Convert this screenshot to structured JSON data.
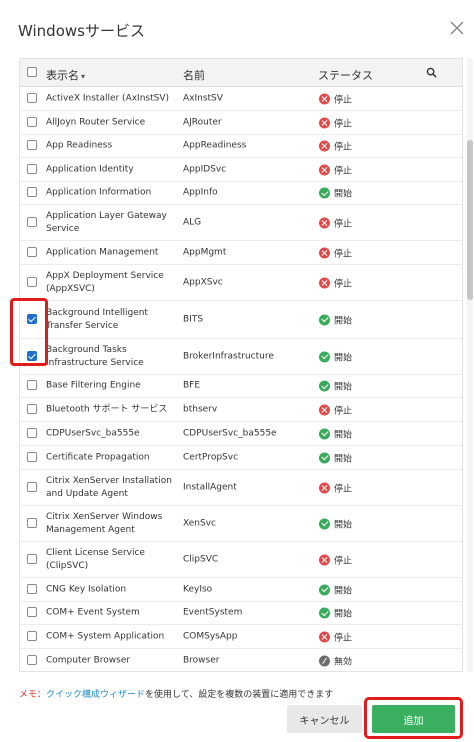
{
  "dialog": {
    "title": "Windowsサービス"
  },
  "table": {
    "headers": {
      "display_name": "表示名",
      "name": "名前",
      "status": "ステータス"
    },
    "rows": [
      {
        "display": "ActiveX Installer (AxInstSV)",
        "name": "AxInstSV",
        "status": "停止",
        "state": "stop",
        "checked": false
      },
      {
        "display": "AllJoyn Router Service",
        "name": "AJRouter",
        "status": "停止",
        "state": "stop",
        "checked": false
      },
      {
        "display": "App Readiness",
        "name": "AppReadiness",
        "status": "停止",
        "state": "stop",
        "checked": false
      },
      {
        "display": "Application Identity",
        "name": "AppIDSvc",
        "status": "停止",
        "state": "stop",
        "checked": false
      },
      {
        "display": "Application Information",
        "name": "AppInfo",
        "status": "開始",
        "state": "run",
        "checked": false
      },
      {
        "display": "Application Layer Gateway Service",
        "name": "ALG",
        "status": "停止",
        "state": "stop",
        "checked": false
      },
      {
        "display": "Application Management",
        "name": "AppMgmt",
        "status": "停止",
        "state": "stop",
        "checked": false
      },
      {
        "display": "AppX Deployment Service (AppXSVC)",
        "name": "AppXSvc",
        "status": "停止",
        "state": "stop",
        "checked": false
      },
      {
        "display": "Background Intelligent Transfer Service",
        "name": "BITS",
        "status": "開始",
        "state": "run",
        "checked": true
      },
      {
        "display": "Background Tasks Infrastructure Service",
        "name": "BrokerInfrastructure",
        "status": "開始",
        "state": "run",
        "checked": true
      },
      {
        "display": "Base Filtering Engine",
        "name": "BFE",
        "status": "開始",
        "state": "run",
        "checked": false
      },
      {
        "display": "Bluetooth サポート サービス",
        "name": "bthserv",
        "status": "停止",
        "state": "stop",
        "checked": false
      },
      {
        "display": "CDPUserSvc_ba555e",
        "name": "CDPUserSvc_ba555e",
        "status": "開始",
        "state": "run",
        "checked": false
      },
      {
        "display": "Certificate Propagation",
        "name": "CertPropSvc",
        "status": "開始",
        "state": "run",
        "checked": false
      },
      {
        "display": "Citrix XenServer Installation and Update Agent",
        "name": "InstallAgent",
        "status": "停止",
        "state": "stop",
        "checked": false
      },
      {
        "display": "Citrix XenServer Windows Management Agent",
        "name": "XenSvc",
        "status": "開始",
        "state": "run",
        "checked": false
      },
      {
        "display": "Client License Service (ClipSVC)",
        "name": "ClipSVC",
        "status": "停止",
        "state": "stop",
        "checked": false
      },
      {
        "display": "CNG Key Isolation",
        "name": "KeyIso",
        "status": "開始",
        "state": "run",
        "checked": false
      },
      {
        "display": "COM+ Event System",
        "name": "EventSystem",
        "status": "開始",
        "state": "run",
        "checked": false
      },
      {
        "display": "COM+ System Application",
        "name": "COMSysApp",
        "status": "停止",
        "state": "stop",
        "checked": false
      },
      {
        "display": "Computer Browser",
        "name": "Browser",
        "status": "無効",
        "state": "disabled",
        "checked": false
      }
    ]
  },
  "footer": {
    "memo_label": "メモ：",
    "memo_link": "クイック構成ウィザード",
    "memo_text": "を使用して、設定を複数の装置に適用できます",
    "cancel_label": "キャンセル",
    "add_label": "追加"
  },
  "icons": {
    "close": "close-icon",
    "search": "search-icon",
    "sort": "sort-icon"
  },
  "colors": {
    "stop": "#e04a4a",
    "run": "#3aaa5c",
    "disabled": "#6d6d6d",
    "add_button": "#3aaf5f",
    "highlight": "#e21b1b",
    "link": "#1e88c9"
  }
}
